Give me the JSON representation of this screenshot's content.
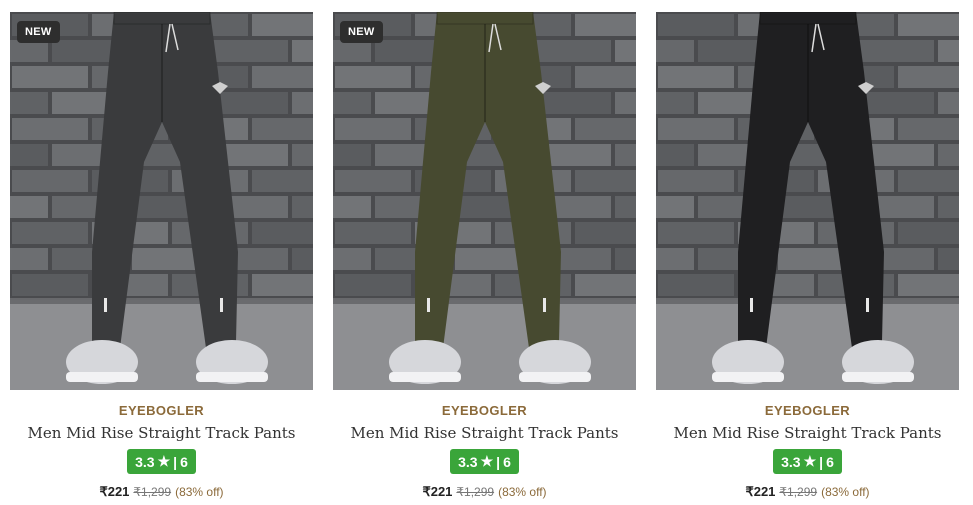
{
  "products": [
    {
      "badge": "NEW",
      "brand": "EYEBOGLER",
      "name": "Men Mid Rise Straight Track Pants",
      "rating": "3.3",
      "star": "★",
      "separator": "|",
      "reviews": "6",
      "price": "₹221",
      "mrp": "₹1,299",
      "discount": "(83% off)",
      "pant_color": "#3a3b3d"
    },
    {
      "badge": "NEW",
      "brand": "EYEBOGLER",
      "name": "Men Mid Rise Straight Track Pants",
      "rating": "3.3",
      "star": "★",
      "separator": "|",
      "reviews": "6",
      "price": "₹221",
      "mrp": "₹1,299",
      "discount": "(83% off)",
      "pant_color": "#474a30"
    },
    {
      "badge": "",
      "brand": "EYEBOGLER",
      "name": "Men Mid Rise Straight Track Pants",
      "rating": "3.3",
      "star": "★",
      "separator": "|",
      "reviews": "6",
      "price": "₹221",
      "mrp": "₹1,299",
      "discount": "(83% off)",
      "pant_color": "#1f1f21"
    }
  ],
  "colors": {
    "brand": "#8b6a3a",
    "rating_bg": "#3aa53a"
  }
}
